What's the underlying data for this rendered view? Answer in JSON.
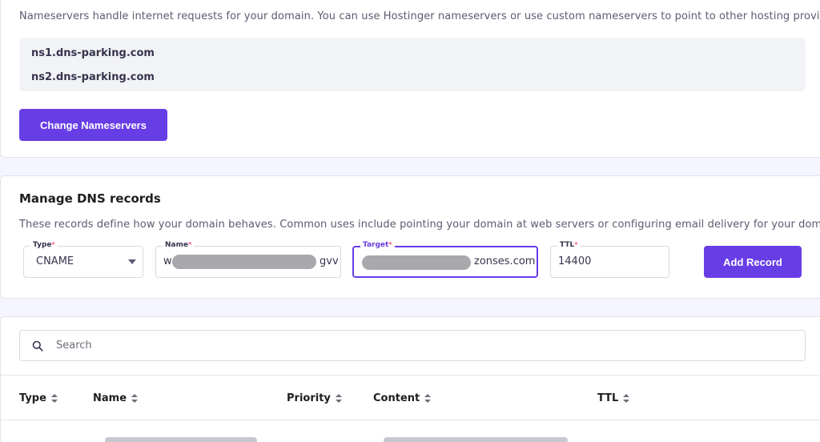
{
  "nameservers": {
    "description": "Nameservers handle internet requests for your domain. You can use Hostinger nameservers or use custom nameservers to point to other hosting provider.",
    "servers": [
      "ns1.dns-parking.com",
      "ns2.dns-parking.com"
    ],
    "change_button": "Change Nameservers"
  },
  "dns": {
    "title": "Manage DNS records",
    "description": "These records define how your domain behaves. Common uses include pointing your domain at web servers or configuring email delivery for your domain.",
    "type": {
      "label": "Type",
      "value": "CNAME"
    },
    "name": {
      "label": "Name",
      "value_start": "w",
      "value_end": "gvv"
    },
    "target": {
      "label": "Target",
      "value_start": "",
      "value_end": "zonses.com"
    },
    "ttl": {
      "label": "TTL",
      "value": "14400"
    },
    "required_mark": "*",
    "add_button": "Add Record"
  },
  "table": {
    "search_placeholder": "Search",
    "columns": [
      "Type",
      "Name",
      "Priority",
      "Content",
      "TTL"
    ]
  },
  "colors": {
    "accent": "#673de6",
    "required": "#fc5185"
  }
}
